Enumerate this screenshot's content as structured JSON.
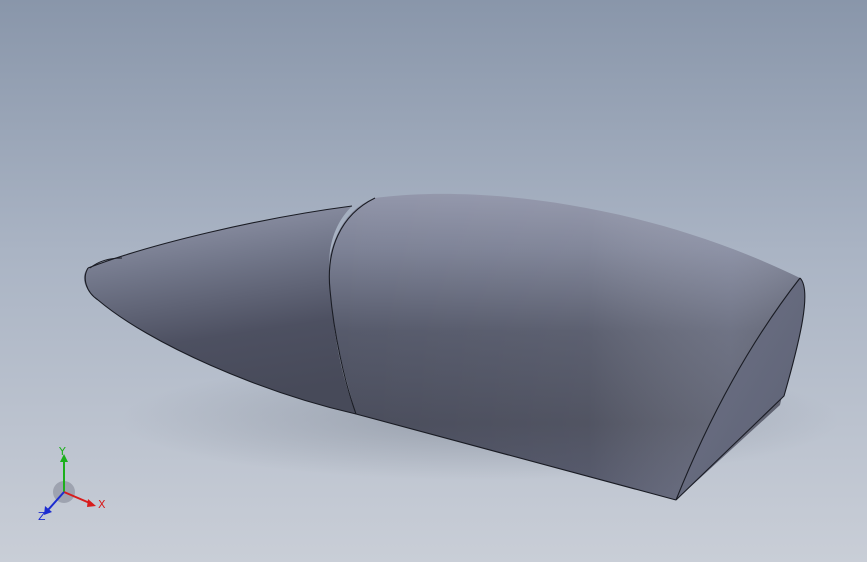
{
  "viewport": {
    "background_top": "#8996aa",
    "background_bottom": "#c9ced7"
  },
  "model": {
    "name": "nose-cone-fairing",
    "body_color": "#4e5262",
    "highlight_color": "#8e94a8",
    "edge_color": "#1a1c24"
  },
  "triad": {
    "x_label": "X",
    "y_label": "Y",
    "z_label": "Z",
    "x_color": "#d81c1c",
    "y_color": "#1cb01c",
    "z_color": "#1c2cd0"
  }
}
